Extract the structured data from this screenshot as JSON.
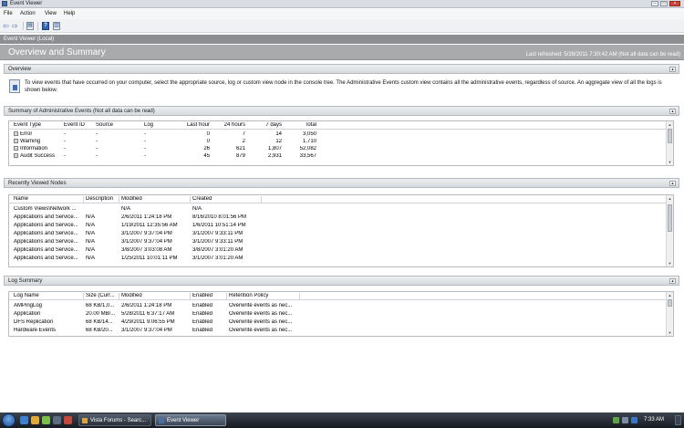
{
  "window": {
    "title": "Event Viewer"
  },
  "menu": [
    "File",
    "Action",
    "View",
    "Help"
  ],
  "path": "Event Viewer (Local)",
  "header": {
    "title": "Overview and Summary",
    "refresh": "Last refreshed: 5/28/2011 7:30:42 AM   (Not all data can be read)"
  },
  "overview": {
    "title": "Overview",
    "text": "To view events that have occurred on your computer, select the appropriate source, log or custom view node in the console tree. The Administrative Events custom view contains all the administrative events, regardless of source. An aggregate view of all the logs is shown below."
  },
  "summary": {
    "title": "Summary of Administrative Events (Not all data can be read)",
    "columns": [
      "Event Type",
      "Event ID",
      "Source",
      "Log",
      "Last hour",
      "24 hours",
      "7 days",
      "Total"
    ],
    "rows": [
      [
        "Error",
        "-",
        "-",
        "-",
        "0",
        "7",
        "14",
        "3,050"
      ],
      [
        "Warning",
        "-",
        "-",
        "-",
        "0",
        "2",
        "12",
        "1,710"
      ],
      [
        "Information",
        "-",
        "-",
        "-",
        "26",
        "621",
        "1,807",
        "52,082"
      ],
      [
        "Audit Success",
        "-",
        "-",
        "-",
        "45",
        "879",
        "2,931",
        "33,567"
      ]
    ]
  },
  "recent": {
    "title": "Recently Viewed Nodes",
    "columns": [
      "Name",
      "Description",
      "Modified",
      "Created"
    ],
    "rows": [
      [
        "Custom Views\\Network ...",
        "",
        "N/A",
        "N/A"
      ],
      [
        "Applications and Service...",
        "N/A",
        "2/6/2011 1:24:18 PM",
        "8/16/2010 8:01:56 PM"
      ],
      [
        "Applications and Service...",
        "N/A",
        "1/19/2011 12:35:56 AM",
        "1/6/2011 10:51:14 PM"
      ],
      [
        "Applications and Service...",
        "N/A",
        "3/1/2007 9:37:04 PM",
        "3/1/2007 9:33:11 PM"
      ],
      [
        "Applications and Service...",
        "N/A",
        "3/1/2007 9:37:04 PM",
        "3/1/2007 9:33:11 PM"
      ],
      [
        "Applications and Service...",
        "N/A",
        "3/8/2007 3:03:08 AM",
        "3/8/2007 3:01:20 AM"
      ],
      [
        "Applications and Service...",
        "N/A",
        "1/25/2011 10:01:11 PM",
        "3/1/2007 3:01:20 AM"
      ]
    ]
  },
  "logs": {
    "title": "Log Summary",
    "columns": [
      "Log Name",
      "Size (Curr...",
      "Modified",
      "Enabled",
      "Retention Policy"
    ],
    "rows": [
      [
        "AMPingLog",
        "68 KB/1,0...",
        "2/6/2011 1:24:18 PM",
        "Enabled",
        "Overwrite events as nec..."
      ],
      [
        "Application",
        "20.00 MB/...",
        "5/28/2011 6:37:17 AM",
        "Enabled",
        "Overwrite events as nec..."
      ],
      [
        "DFS Replication",
        "68 KB/14...",
        "4/29/2011 9:06:55 PM",
        "Enabled",
        "Overwrite events as nec..."
      ],
      [
        "Hardware Events",
        "68 KB/20...",
        "3/1/2007 9:37:04 PM",
        "Enabled",
        "Overwrite events as nec..."
      ]
    ]
  },
  "taskbar": {
    "tasks": [
      "Vista Forums - Searc...",
      "Event Viewer"
    ],
    "clock": "7:33 AM"
  },
  "colors": {
    "path_bar": "#8c8e92",
    "header": "#a9aaac",
    "help_icon": "#3463b5"
  }
}
